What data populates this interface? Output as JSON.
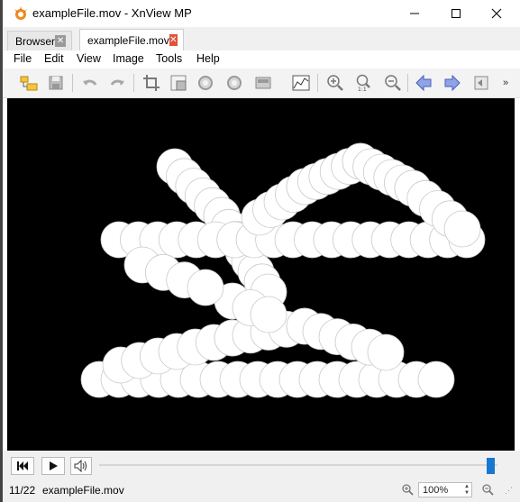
{
  "window": {
    "title": "exampleFile.mov - XnView MP",
    "controls": {
      "minimize_icon": "minimize-icon",
      "maximize_icon": "maximize-icon",
      "close_icon": "close-icon"
    }
  },
  "tabs": [
    {
      "label": "Browser",
      "active": false
    },
    {
      "label": "exampleFile.mov",
      "active": true
    }
  ],
  "menu": [
    "File",
    "Edit",
    "View",
    "Image",
    "Tools",
    "Help"
  ],
  "toolbar": {
    "icons": [
      "open-folder-icon",
      "save-icon",
      "undo-icon",
      "redo-icon",
      "crop-icon",
      "resize-icon",
      "rotate-left-icon",
      "rotate-right-icon",
      "adjust-icon",
      "histogram-icon",
      "zoom-in-icon",
      "zoom-actual-icon",
      "zoom-out-icon",
      "previous-icon",
      "next-icon",
      "fullscreen-icon"
    ]
  },
  "player": {
    "controls": [
      "rewind-icon",
      "play-icon",
      "volume-icon"
    ],
    "position_fraction": 0.98
  },
  "status": {
    "frame": "11/22",
    "filename": "exampleFile.mov",
    "zoom": "100%"
  },
  "colors": {
    "accent": "#1778d2",
    "viewer_bg": "#000000",
    "tab_close_active": "#e0533b"
  }
}
